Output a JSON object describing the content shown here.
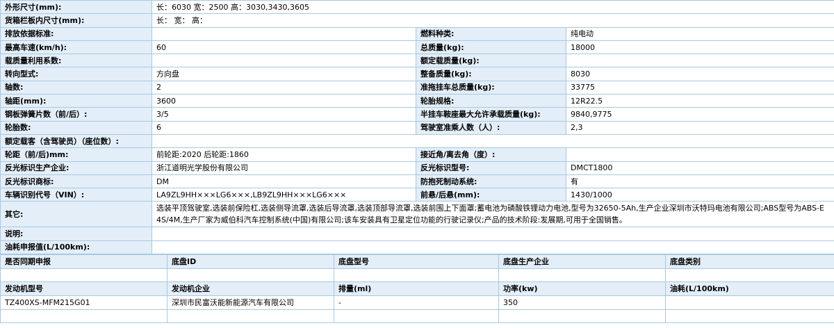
{
  "spec": {
    "dimensions": {
      "label": "外形尺寸(mm):",
      "value": "长：6030 宽：2500 高：3030,3430,3605"
    },
    "cargo_dims": {
      "label": "货箱栏板内尺寸(mm):",
      "value": "长：  宽：  高："
    },
    "rows": [
      {
        "l1": "排放依据标准:",
        "v1": "",
        "l2": "燃料种类:",
        "v2": "纯电动"
      },
      {
        "l1": "最高车速(km/h):",
        "v1": "60",
        "l2": "总质量(kg):",
        "v2": "18000"
      },
      {
        "l1": "载质量利用系数:",
        "v1": "",
        "l2": "额定载质量(kg):",
        "v2": ""
      },
      {
        "l1": "转向型式:",
        "v1": "方向盘",
        "l2": "整备质量(kg):",
        "v2": "8030"
      },
      {
        "l1": "轴数:",
        "v1": "2",
        "l2": "准拖挂车总质量(kg):",
        "v2": "33775"
      },
      {
        "l1": "轴距(mm):",
        "v1": "3600",
        "l2": "轮胎规格:",
        "v2": "12R22.5"
      },
      {
        "l1": "钢板弹簧片数（前/后）:",
        "v1": "3/5",
        "l2": "半挂车鞍座最大允许承载质量(kg):",
        "v2": "9840,9775"
      },
      {
        "l1": "轮胎数:",
        "v1": "6",
        "l2": "驾驶室准乘人数（人）:",
        "v2": "2,3"
      }
    ],
    "rated_passengers": {
      "label": "额定载客（含驾驶员）（座位数）:",
      "value": ""
    },
    "rows2": [
      {
        "l1": "轮距（前/后)mm:",
        "v1": "前轮距:2020 后轮距:1860",
        "l2": "接近角/离去角（度）:",
        "v2": ""
      },
      {
        "l1": "反光标识生产企业:",
        "v1": "浙江道明光学股份有限公司",
        "l2": "反光标识型号:",
        "v2": "DMCT1800"
      },
      {
        "l1": "反光标识商标:",
        "v1": "DM",
        "l2": "防抱死制动系统:",
        "v2": "有"
      },
      {
        "l1": "车辆识别代号（VIN）:",
        "v1": "LA9ZL9HH×××LG6×××,LB9ZL9HH×××LG6×××",
        "l2": "前悬/后悬(mm):",
        "v2": "1430/1000"
      }
    ],
    "other": {
      "label": "其它:",
      "value": "选装平顶驾驶室,选装前保险杠,选装侧导流罩,选装后导流罩,选装顶部导流罩,选装前围上下面罩;蓄电池为磷酸铁锂动力电池,型号为32650-5Ah,生产企业深圳市沃特玛电池有限公司;ABS型号为ABS-E 4S/4M,生产厂家为威伯科汽车控制系统(中国)有限公司;该车安装具有卫星定位功能的行驶记录仪;产品的技术阶段:发展期,可用于全国销售。"
    },
    "note": {
      "label": "说明:",
      "value": ""
    },
    "fuel": {
      "label": "油耗申报值(L/100km):",
      "value": ""
    }
  },
  "chassis": {
    "headers": [
      "是否同期申报",
      "底盘ID",
      "底盘型号",
      "底盘生产企业",
      "底盘类别"
    ],
    "values": [
      "",
      "",
      "",
      "",
      ""
    ]
  },
  "engine": {
    "headers": [
      "发动机型号",
      "发动机企业",
      "排量(ml)",
      "功率(kw)",
      "油耗(L/100km)"
    ],
    "values": [
      "TZ400XS-MFM215G01",
      "深圳市民富沃能新能源汽车有限公司",
      "-",
      "350",
      ""
    ]
  }
}
